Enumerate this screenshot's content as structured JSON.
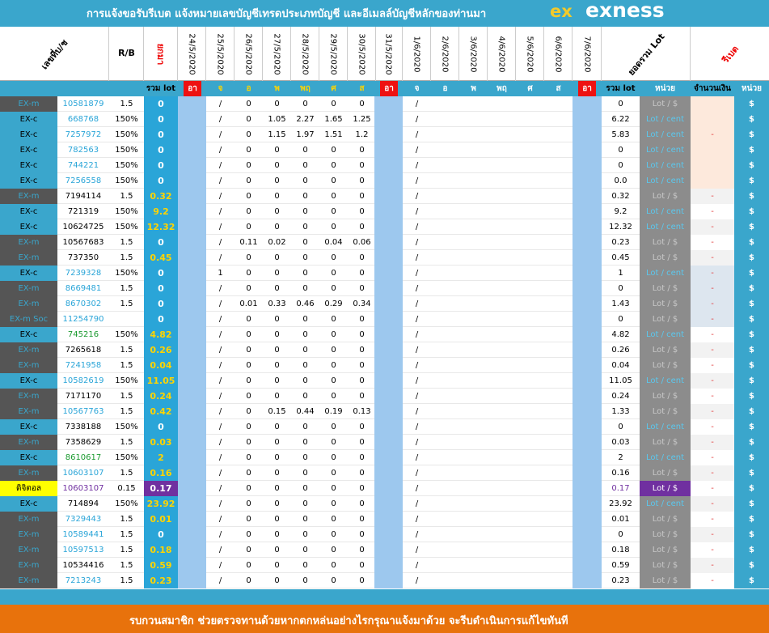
{
  "header": {
    "title": "การแจ้งขอรับรีเบต  แจ้งหมายเลขบัญชีเทรดประเภทบัญชี และอีเมลล์บัญชีหลักของท่านมา",
    "logo_text": "exness",
    "logo_mark": "ex"
  },
  "columns": {
    "account": "เลขที่บ/ช",
    "rb": "R/B",
    "prev": "ยกมา",
    "dates": [
      "24/5/2020",
      "25/5/2020",
      "26/5/2020",
      "27/5/2020",
      "28/5/2020",
      "29/5/2020",
      "30/5/2020",
      "31/5/2020",
      "1/6/2020",
      "2/6/2020",
      "3/6/2020",
      "4/6/2020",
      "5/6/2020",
      "6/6/2020",
      "7/6/2020"
    ],
    "lot_total": "ยอดรวม Lot",
    "rebate": "รีเบต"
  },
  "subheader": {
    "sum_lot": "รวม lot",
    "days": [
      "อา",
      "จ",
      "อ",
      "พ",
      "พฤ",
      "ศ",
      "ส",
      "อา",
      "จ",
      "อ",
      "พ",
      "พฤ",
      "ศ",
      "ส",
      "อา"
    ],
    "sum_lot2": "รวม lot",
    "unit": "หน่วย",
    "amount": "จำนวนเงิน",
    "unit2": "หน่วย"
  },
  "rows": [
    {
      "type": "EX-m",
      "acc": "10581879",
      "rb": "1.5",
      "tot": "0",
      "d25": "/",
      "d26": "0",
      "d27": "0",
      "d28": "0",
      "d29": "0",
      "d30": "0",
      "d1": "/",
      "sum": "0",
      "unit": "Lot / $",
      "amt": "",
      "dol": "$"
    },
    {
      "type": "EX-c",
      "acc": "668768",
      "rb": "150%",
      "tot": "0",
      "d25": "/",
      "d26": "0",
      "d27": "1.05",
      "d28": "2.27",
      "d29": "1.65",
      "d30": "1.25",
      "d1": "/",
      "sum": "6.22",
      "unit": "Lot / cent",
      "amt": "",
      "dol": "$"
    },
    {
      "type": "EX-c",
      "acc": "7257972",
      "rb": "150%",
      "tot": "0",
      "d25": "/",
      "d26": "0",
      "d27": "1.15",
      "d28": "1.97",
      "d29": "1.51",
      "d30": "1.2",
      "d1": "/",
      "sum": "5.83",
      "unit": "Lot / cent",
      "amt": "-",
      "dol": "$"
    },
    {
      "type": "EX-c",
      "acc": "782563",
      "rb": "150%",
      "tot": "0",
      "d25": "/",
      "d26": "0",
      "d27": "0",
      "d28": "0",
      "d29": "0",
      "d30": "0",
      "d1": "/",
      "sum": "0",
      "unit": "Lot / cent",
      "amt": "",
      "dol": "$"
    },
    {
      "type": "EX-c",
      "acc": "744221",
      "rb": "150%",
      "tot": "0",
      "d25": "/",
      "d26": "0",
      "d27": "0",
      "d28": "0",
      "d29": "0",
      "d30": "0",
      "d1": "/",
      "sum": "0",
      "unit": "Lot / cent",
      "amt": "",
      "dol": "$"
    },
    {
      "type": "EX-c",
      "acc": "7256558",
      "rb": "150%",
      "tot": "0",
      "d25": "/",
      "d26": "0",
      "d27": "0",
      "d28": "0",
      "d29": "0",
      "d30": "0",
      "d1": "/",
      "sum": "0.0",
      "unit": "Lot / cent",
      "amt": "",
      "dol": "$"
    },
    {
      "type": "EX-m",
      "acc": "7194114",
      "rb": "1.5",
      "tot": "0.32",
      "d25": "/",
      "d26": "0",
      "d27": "0",
      "d28": "0",
      "d29": "0",
      "d30": "0",
      "d1": "/",
      "sum": "0.32",
      "unit": "Lot / $",
      "amt": "-",
      "dol": "$"
    },
    {
      "type": "EX-c",
      "acc": "721319",
      "rb": "150%",
      "tot": "9.2",
      "d25": "/",
      "d26": "0",
      "d27": "0",
      "d28": "0",
      "d29": "0",
      "d30": "0",
      "d1": "/",
      "sum": "9.2",
      "unit": "Lot / cent",
      "amt": "-",
      "dol": "$"
    },
    {
      "type": "EX-c",
      "acc": "10624725",
      "rb": "150%",
      "tot": "12.32",
      "d25": "/",
      "d26": "0",
      "d27": "0",
      "d28": "0",
      "d29": "0",
      "d30": "0",
      "d1": "/",
      "sum": "12.32",
      "unit": "Lot / cent",
      "amt": "-",
      "dol": "$"
    },
    {
      "type": "EX-m",
      "acc": "10567683",
      "rb": "1.5",
      "tot": "0",
      "d25": "/",
      "d26": "0.11",
      "d27": "0.02",
      "d28": "0",
      "d29": "0.04",
      "d30": "0.06",
      "d1": "/",
      "sum": "0.23",
      "unit": "Lot / $",
      "amt": "-",
      "dol": "$"
    },
    {
      "type": "EX-m",
      "acc": "737350",
      "rb": "1.5",
      "tot": "0.45",
      "d25": "/",
      "d26": "0",
      "d27": "0",
      "d28": "0",
      "d29": "0",
      "d30": "0",
      "d1": "/",
      "sum": "0.45",
      "unit": "Lot / $",
      "amt": "-",
      "dol": "$"
    },
    {
      "type": "EX-c",
      "acc": "7239328",
      "rb": "150%",
      "tot": "0",
      "d25": "1",
      "d26": "0",
      "d27": "0",
      "d28": "0",
      "d29": "0",
      "d30": "0",
      "d1": "/",
      "sum": "1",
      "unit": "Lot / cent",
      "amt": "-",
      "dol": "$"
    },
    {
      "type": "EX-m",
      "acc": "8669481",
      "rb": "1.5",
      "tot": "0",
      "d25": "/",
      "d26": "0",
      "d27": "0",
      "d28": "0",
      "d29": "0",
      "d30": "0",
      "d1": "/",
      "sum": "0",
      "unit": "Lot / $",
      "amt": "-",
      "dol": "$"
    },
    {
      "type": "EX-m",
      "acc": "8670302",
      "rb": "1.5",
      "tot": "0",
      "d25": "/",
      "d26": "0.01",
      "d27": "0.33",
      "d28": "0.46",
      "d29": "0.29",
      "d30": "0.34",
      "d1": "/",
      "sum": "1.43",
      "unit": "Lot / $",
      "amt": "-",
      "dol": "$"
    },
    {
      "type": "EX-m Soc",
      "acc": "11254790",
      "rb": "",
      "tot": "0",
      "d25": "/",
      "d26": "0",
      "d27": "0",
      "d28": "0",
      "d29": "0",
      "d30": "0",
      "d1": "/",
      "sum": "0",
      "unit": "Lot / $",
      "amt": "-",
      "dol": "$"
    },
    {
      "type": "EX-c",
      "acc": "745216",
      "rb": "150%",
      "tot": "4.82",
      "d25": "/",
      "d26": "0",
      "d27": "0",
      "d28": "0",
      "d29": "0",
      "d30": "0",
      "d1": "/",
      "sum": "4.82",
      "unit": "Lot / cent",
      "amt": "-",
      "dol": "$"
    },
    {
      "type": "EX-m",
      "acc": "7265618",
      "rb": "1.5",
      "tot": "0.26",
      "d25": "/",
      "d26": "0",
      "d27": "0",
      "d28": "0",
      "d29": "0",
      "d30": "0",
      "d1": "/",
      "sum": "0.26",
      "unit": "Lot / $",
      "amt": "-",
      "dol": "$"
    },
    {
      "type": "EX-m",
      "acc": "7241958",
      "rb": "1.5",
      "tot": "0.04",
      "d25": "/",
      "d26": "0",
      "d27": "0",
      "d28": "0",
      "d29": "0",
      "d30": "0",
      "d1": "/",
      "sum": "0.04",
      "unit": "Lot / $",
      "amt": "-",
      "dol": "$"
    },
    {
      "type": "EX-c",
      "acc": "10582619",
      "rb": "150%",
      "tot": "11.05",
      "d25": "/",
      "d26": "0",
      "d27": "0",
      "d28": "0",
      "d29": "0",
      "d30": "0",
      "d1": "/",
      "sum": "11.05",
      "unit": "Lot / cent",
      "amt": "-",
      "dol": "$"
    },
    {
      "type": "EX-m",
      "acc": "7171170",
      "rb": "1.5",
      "tot": "0.24",
      "d25": "/",
      "d26": "0",
      "d27": "0",
      "d28": "0",
      "d29": "0",
      "d30": "0",
      "d1": "/",
      "sum": "0.24",
      "unit": "Lot / $",
      "amt": "-",
      "dol": "$"
    },
    {
      "type": "EX-m",
      "acc": "10567763",
      "rb": "1.5",
      "tot": "0.42",
      "d25": "/",
      "d26": "0",
      "d27": "0.15",
      "d28": "0.44",
      "d29": "0.19",
      "d30": "0.13",
      "d1": "/",
      "sum": "1.33",
      "unit": "Lot / $",
      "amt": "-",
      "dol": "$"
    },
    {
      "type": "EX-c",
      "acc": "7338188",
      "rb": "150%",
      "tot": "0",
      "d25": "/",
      "d26": "0",
      "d27": "0",
      "d28": "0",
      "d29": "0",
      "d30": "0",
      "d1": "/",
      "sum": "0",
      "unit": "Lot / cent",
      "amt": "-",
      "dol": "$"
    },
    {
      "type": "EX-m",
      "acc": "7358629",
      "rb": "1.5",
      "tot": "0.03",
      "d25": "/",
      "d26": "0",
      "d27": "0",
      "d28": "0",
      "d29": "0",
      "d30": "0",
      "d1": "/",
      "sum": "0.03",
      "unit": "Lot / $",
      "amt": "-",
      "dol": "$"
    },
    {
      "type": "EX-c",
      "acc": "8610617",
      "rb": "150%",
      "tot": "2",
      "d25": "/",
      "d26": "0",
      "d27": "0",
      "d28": "0",
      "d29": "0",
      "d30": "0",
      "d1": "/",
      "sum": "2",
      "unit": "Lot / cent",
      "amt": "-",
      "dol": "$"
    },
    {
      "type": "EX-m",
      "acc": "10603107",
      "rb": "1.5",
      "tot": "0.16",
      "d25": "/",
      "d26": "0",
      "d27": "0",
      "d28": "0",
      "d29": "0",
      "d30": "0",
      "d1": "/",
      "sum": "0.16",
      "unit": "Lot / $",
      "amt": "-",
      "dol": "$"
    },
    {
      "type": "ดิจิตอล",
      "acc": "10603107",
      "rb": "0.15",
      "tot": "0.17",
      "d25": "/",
      "d26": "0",
      "d27": "0",
      "d28": "0",
      "d29": "0",
      "d30": "0",
      "d1": "/",
      "sum": "0.17",
      "unit": "Lot / $",
      "amt": "-",
      "dol": "$"
    },
    {
      "type": "EX-c",
      "acc": "714894",
      "rb": "150%",
      "tot": "23.92",
      "d25": "/",
      "d26": "0",
      "d27": "0",
      "d28": "0",
      "d29": "0",
      "d30": "0",
      "d1": "/",
      "sum": "23.92",
      "unit": "Lot / cent",
      "amt": "-",
      "dol": "$"
    },
    {
      "type": "EX-m",
      "acc": "7329443",
      "rb": "1.5",
      "tot": "0.01",
      "d25": "/",
      "d26": "0",
      "d27": "0",
      "d28": "0",
      "d29": "0",
      "d30": "0",
      "d1": "/",
      "sum": "0.01",
      "unit": "Lot / $",
      "amt": "-",
      "dol": "$"
    },
    {
      "type": "EX-m",
      "acc": "10589441",
      "rb": "1.5",
      "tot": "0",
      "d25": "/",
      "d26": "0",
      "d27": "0",
      "d28": "0",
      "d29": "0",
      "d30": "0",
      "d1": "/",
      "sum": "0",
      "unit": "Lot / $",
      "amt": "-",
      "dol": "$"
    },
    {
      "type": "EX-m",
      "acc": "10597513",
      "rb": "1.5",
      "tot": "0.18",
      "d25": "/",
      "d26": "0",
      "d27": "0",
      "d28": "0",
      "d29": "0",
      "d30": "0",
      "d1": "/",
      "sum": "0.18",
      "unit": "Lot / $",
      "amt": "-",
      "dol": "$"
    },
    {
      "type": "EX-m",
      "acc": "10534416",
      "rb": "1.5",
      "tot": "0.59",
      "d25": "/",
      "d26": "0",
      "d27": "0",
      "d28": "0",
      "d29": "0",
      "d30": "0",
      "d1": "/",
      "sum": "0.59",
      "unit": "Lot / $",
      "amt": "-",
      "dol": "$"
    },
    {
      "type": "EX-m",
      "acc": "7213243",
      "rb": "1.5",
      "tot": "0.23",
      "d25": "/",
      "d26": "0",
      "d27": "0",
      "d28": "0",
      "d29": "0",
      "d30": "0",
      "d1": "/",
      "sum": "0.23",
      "unit": "Lot / $",
      "amt": "-",
      "dol": "$"
    }
  ],
  "footer": {
    "message": "รบกวนสมาชิก ช่วยตรวจทานด้วยหากตกหล่นอย่างไรกรุณาแจ้งมาด้วย จะรีบดำเนินการแก้ไขทันที"
  },
  "colors": {
    "accent": "#3aa6cc",
    "dark_cell": "#555555",
    "red_day": "#ee1111",
    "orange_footer": "#e8720c",
    "purple_row": "#7030a0",
    "yellow_label": "#ffff00"
  }
}
